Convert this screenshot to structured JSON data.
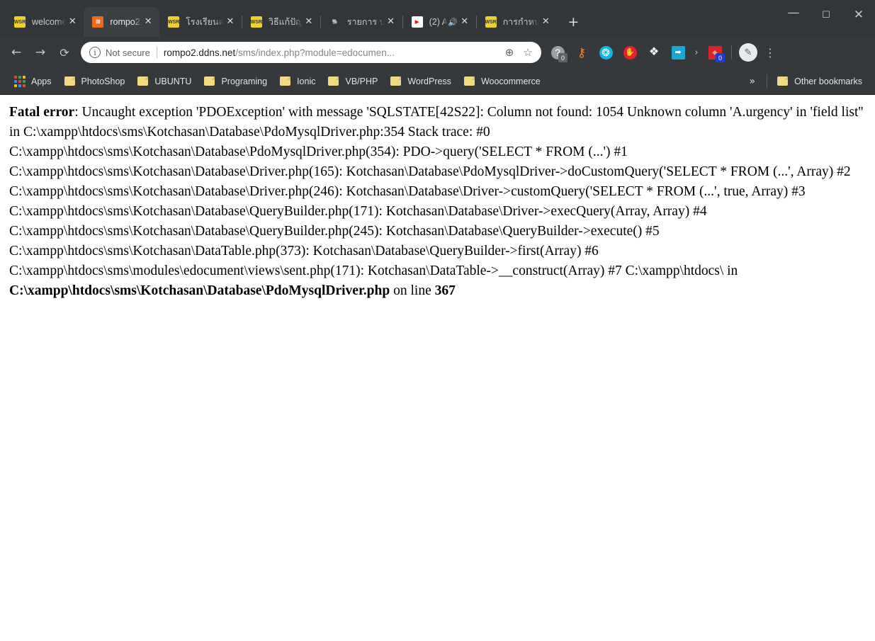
{
  "window": {
    "controls": {
      "minimize": "—",
      "maximize": "☐",
      "close": "✕"
    }
  },
  "tabs": [
    {
      "title": "welcome",
      "favicon": "wsr-icon",
      "favicon_text": "WSR",
      "active": false,
      "close": "✕"
    },
    {
      "title": "rompo2.",
      "favicon": "xampp-icon",
      "favicon_text": "☒",
      "active": true,
      "close": "✕"
    },
    {
      "title": "โรงเรียนค",
      "favicon": "wsr-icon",
      "favicon_text": "WSR",
      "active": false,
      "close": "✕"
    },
    {
      "title": "วิธีแก้ปัญ",
      "favicon": "wsr-icon",
      "favicon_text": "WSR",
      "active": false,
      "close": "✕"
    },
    {
      "title": "รายการ บ",
      "favicon": "elephant-icon",
      "favicon_text": "🐘",
      "active": false,
      "close": "✕"
    },
    {
      "title": "(2) A",
      "favicon": "youtube-icon",
      "favicon_text": "▶",
      "active": false,
      "close": "✕",
      "mute": "🔊"
    },
    {
      "title": "การกำหน",
      "favicon": "wsr-icon",
      "favicon_text": "WSR",
      "active": false,
      "close": "✕"
    }
  ],
  "newtab_label": "+",
  "toolbar": {
    "back": "←",
    "forward": "→",
    "reload": "⟳",
    "security_icon": "i",
    "security_label": "Not secure",
    "url_host": "rompo2.ddns.net",
    "url_path": "/sms/index.php?module=edocumen...",
    "zoom_icon": "⊕",
    "bookmark_star": "☆",
    "extensions": [
      {
        "name": "question-badge-extension",
        "glyph": "?",
        "fg": "#ffffff",
        "bg": "#9aa0a6",
        "badge": "0",
        "badge_bg": "#5f6368"
      },
      {
        "name": "key-extension",
        "glyph": "⚷",
        "fg": "#f28b22",
        "bg": "transparent",
        "badge": "",
        "badge_bg": ""
      },
      {
        "name": "share-node-extension",
        "glyph": "❂",
        "fg": "#ffffff",
        "bg": "#10b6e0",
        "badge": "",
        "badge_bg": ""
      },
      {
        "name": "adblock-hand-extension",
        "glyph": "✋",
        "fg": "#ffffff",
        "bg": "#e8202a",
        "badge": "",
        "badge_bg": ""
      },
      {
        "name": "dropbox-extension",
        "glyph": "❖",
        "fg": "#ffffff",
        "bg": "transparent",
        "badge": "",
        "badge_bg": ""
      },
      {
        "name": "export-arrow-extension",
        "glyph": "➡",
        "fg": "#ffffff",
        "bg": "#1ba6d4",
        "badge": "",
        "badge_bg": ""
      }
    ],
    "extensions_overflow": "›",
    "pinned_extension": {
      "name": "target-extension",
      "glyph": "⌖",
      "fg": "#ffffff",
      "bg": "#d8252a",
      "badge": "0",
      "badge_bg": "#1a3fd8"
    },
    "avatar_glyph": "✎",
    "menu_glyph": "⋮"
  },
  "bookmarks": {
    "apps_label": "Apps",
    "apps_colors": [
      "#ea4335",
      "#34a853",
      "#fbbc04",
      "#4285f4",
      "#ea4335",
      "#34a853",
      "#fbbc04",
      "#4285f4",
      "#ea4335"
    ],
    "items": [
      {
        "label": "PhotoShop"
      },
      {
        "label": "UBUNTU"
      },
      {
        "label": "Programing"
      },
      {
        "label": "Ionic"
      },
      {
        "label": "VB/PHP"
      },
      {
        "label": "WordPress"
      },
      {
        "label": "Woocommerce"
      }
    ],
    "overflow": "»",
    "other_label": "Other bookmarks"
  },
  "content": {
    "error_label": "Fatal error",
    "error_body": ": Uncaught exception 'PDOException' with message 'SQLSTATE[42S22]: Column not found: 1054 Unknown column 'A.urgency' in 'field list'' in C:\\xampp\\htdocs\\sms\\Kotchasan\\Database\\PdoMysqlDriver.php:354 Stack trace: #0 C:\\xampp\\htdocs\\sms\\Kotchasan\\Database\\PdoMysqlDriver.php(354): PDO->query('SELECT * FROM (...') #1 C:\\xampp\\htdocs\\sms\\Kotchasan\\Database\\Driver.php(165): Kotchasan\\Database\\PdoMysqlDriver->doCustomQuery('SELECT * FROM (...', Array) #2 C:\\xampp\\htdocs\\sms\\Kotchasan\\Database\\Driver.php(246): Kotchasan\\Database\\Driver->customQuery('SELECT * FROM (...', true, Array) #3 C:\\xampp\\htdocs\\sms\\Kotchasan\\Database\\QueryBuilder.php(171): Kotchasan\\Database\\Driver->execQuery(Array, Array) #4 C:\\xampp\\htdocs\\sms\\Kotchasan\\Database\\QueryBuilder.php(245): Kotchasan\\Database\\QueryBuilder->execute() #5 C:\\xampp\\htdocs\\sms\\Kotchasan\\DataTable.php(373): Kotchasan\\Database\\QueryBuilder->first(Array) #6 C:\\xampp\\htdocs\\sms\\modules\\edocument\\views\\sent.php(171): Kotchasan\\DataTable->__construct(Array) #7 C:\\xampp\\htdocs\\ in ",
    "error_file": "C:\\xampp\\htdocs\\sms\\Kotchasan\\Database\\PdoMysqlDriver.php",
    "error_on_line_label": " on line ",
    "error_line": "367"
  }
}
